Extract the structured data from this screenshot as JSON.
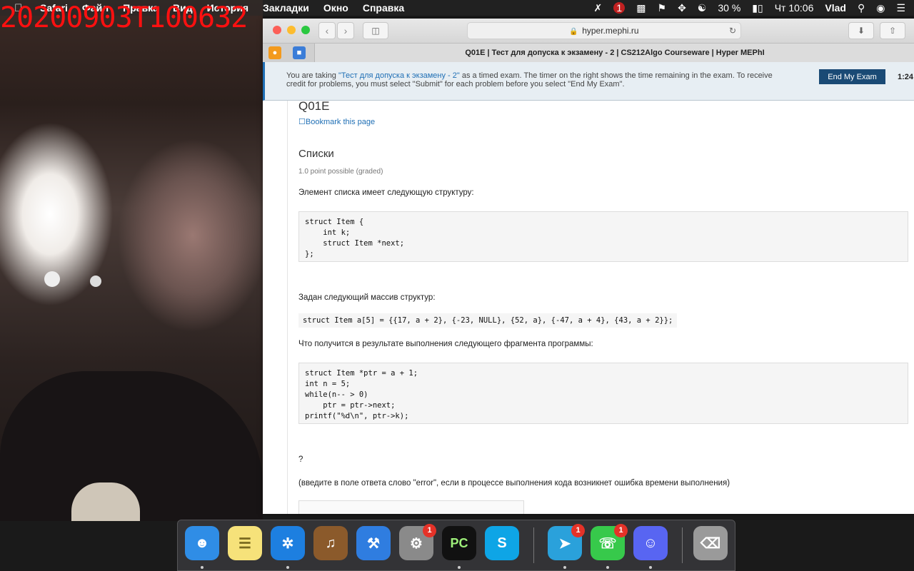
{
  "overlay": {
    "timestamp": "20200903T100632"
  },
  "menubar": {
    "items": [
      "Safari",
      "Файл",
      "Правка",
      "Вид",
      "История",
      "Закладки",
      "Окно",
      "Справка"
    ],
    "battery": "30 %",
    "clock": "Чт 10:06",
    "user": "Vlad",
    "notif_count": "1"
  },
  "browser": {
    "url": "hyper.mephi.ru",
    "tab_title": "Q01E | Тест для допуска к экзамену - 2 | CS212Algo Courseware | Hyper MEPhI"
  },
  "banner": {
    "text_before": "You are taking ",
    "exam_link": "\"Тест для допуска к экзамену - 2\"",
    "text_after": " as a timed exam. The timer on the right shows the time remaining in the exam. To receive credit for problems, you must select \"Submit\" for each problem before you select \"End My Exam\".",
    "end_button": "End My Exam",
    "timer": "1:24:"
  },
  "problem": {
    "id": "Q01E",
    "bookmark": "Bookmark this page",
    "title": "Списки",
    "points": "1.0 point possible (graded)",
    "intro": "Элемент списка имеет следующую структуру:",
    "struct_code": "struct Item {\n    int k;\n    struct Item *next;\n};",
    "array_intro": "Задан следующий массив структур:",
    "array_code": "struct Item a[5] = {{17, a + 2}, {-23, NULL}, {52, a}, {-47, a + 4}, {43, a + 2}};",
    "question": "Что получится в результате выполнения следующего фрагмента программы:",
    "program_code": "struct Item *ptr = a + 1;\nint n = 5;\nwhile(n-- > 0)\n    ptr = ptr->next;\nprintf(\"%d\\n\", ptr->k);",
    "qmark": "?",
    "note": "(введите в поле ответа слово \"error\", если в процессе выполнения кода возникнет ошибка времени выполнения)"
  },
  "dock": {
    "apps": [
      {
        "name": "Finder",
        "icon": "finder-icon",
        "color": "#2f8de6"
      },
      {
        "name": "Notes",
        "icon": "notes-icon",
        "color": "#f6e27a"
      },
      {
        "name": "Safari",
        "icon": "safari-icon",
        "color": "#1d7fe0"
      },
      {
        "name": "GarageBand",
        "icon": "guitar-icon",
        "color": "#8b5a2b"
      },
      {
        "name": "Xcode",
        "icon": "xcode-icon",
        "color": "#2f7de0"
      },
      {
        "name": "System Preferences",
        "icon": "gear-icon",
        "color": "#8a8a8a",
        "badge": "1"
      },
      {
        "name": "PyCharm",
        "icon": "pycharm-icon",
        "color": "#111111",
        "label": "PC"
      },
      {
        "name": "Skype",
        "icon": "skype-icon",
        "color": "#0ea5e6"
      },
      {
        "name": "Telegram",
        "icon": "telegram-icon",
        "color": "#2aa1db",
        "badge": "1"
      },
      {
        "name": "FaceTime",
        "icon": "facetime-icon",
        "color": "#37c94b",
        "badge": "1"
      },
      {
        "name": "Discord",
        "icon": "discord-icon",
        "color": "#5865f2"
      },
      {
        "name": "Trash",
        "icon": "trash-icon",
        "color": "#9a9a9a"
      }
    ]
  }
}
